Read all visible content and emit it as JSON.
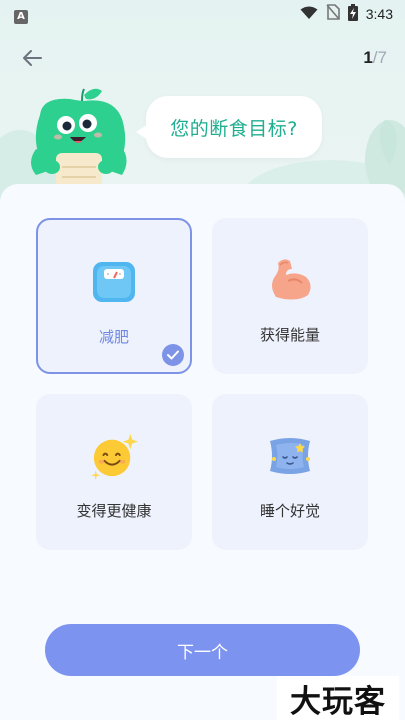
{
  "status_bar": {
    "app_badge": "A",
    "time": "3:43",
    "icons": [
      "wifi-icon",
      "no-sim-icon",
      "battery-charging-icon"
    ]
  },
  "header": {
    "back_icon": "arrow-left-icon",
    "page_current": "1",
    "page_separator": "/",
    "page_total": "7"
  },
  "prompt": {
    "question": "您的断食目标?"
  },
  "options": [
    {
      "label": "减肥",
      "icon": "scale-icon",
      "selected": true
    },
    {
      "label": "获得能量",
      "icon": "flexed-bicep-icon",
      "selected": false
    },
    {
      "label": "变得更健康",
      "icon": "sparkling-smiley-icon",
      "selected": false
    },
    {
      "label": "睡个好觉",
      "icon": "sleeping-pillow-icon",
      "selected": false
    }
  ],
  "footer": {
    "next_label": "下一个"
  },
  "watermark": {
    "text": "大玩客"
  },
  "colors": {
    "accent": "#7d93f0",
    "selected_border": "#7d93e8",
    "question_green": "#1fae8f",
    "mascot_green": "#2ed08f",
    "card_bg": "#eef2fd"
  }
}
